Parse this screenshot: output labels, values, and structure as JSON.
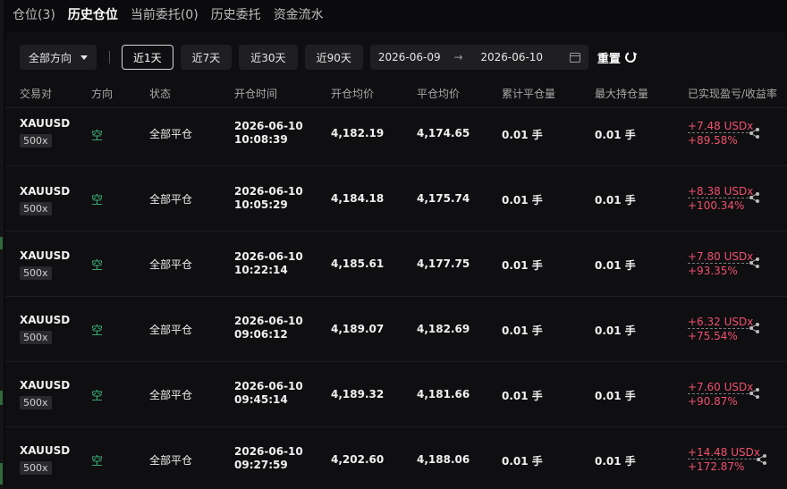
{
  "tabs": [
    {
      "label": "仓位(3)",
      "active": false
    },
    {
      "label": "历史仓位",
      "active": true
    },
    {
      "label": "当前委托(0)",
      "active": false
    },
    {
      "label": "历史委托",
      "active": false
    },
    {
      "label": "资金流水",
      "active": false
    }
  ],
  "filters": {
    "direction": "全部方向",
    "ranges": [
      "近1天",
      "近7天",
      "近30天",
      "近90天"
    ],
    "active_range": 0,
    "date_from": "2026-06-09",
    "date_arrow": "→",
    "date_to": "2026-06-10",
    "reset_label": "重置"
  },
  "columns": [
    "交易对",
    "方向",
    "状态",
    "开仓时间",
    "开仓均价",
    "平仓均价",
    "累计平仓量",
    "最大持仓量",
    "已实现盈亏/收益率"
  ],
  "rows": [
    {
      "symbol": "XAUUSD",
      "leverage": "500x",
      "direction": "空",
      "status": "全部平仓",
      "date": "2026-06-10",
      "time": "10:08:39",
      "open_price": "4,182.19",
      "close_price": "4,174.65",
      "closed_qty": "0.01 手",
      "max_qty": "0.01 手",
      "pnl": "+7.48 USDx",
      "roi": "+89.58%"
    },
    {
      "symbol": "XAUUSD",
      "leverage": "500x",
      "direction": "空",
      "status": "全部平仓",
      "date": "2026-06-10",
      "time": "10:05:29",
      "open_price": "4,184.18",
      "close_price": "4,175.74",
      "closed_qty": "0.01 手",
      "max_qty": "0.01 手",
      "pnl": "+8.38 USDx",
      "roi": "+100.34%"
    },
    {
      "symbol": "XAUUSD",
      "leverage": "500x",
      "direction": "空",
      "status": "全部平仓",
      "date": "2026-06-10",
      "time": "10:22:14",
      "open_price": "4,185.61",
      "close_price": "4,177.75",
      "closed_qty": "0.01 手",
      "max_qty": "0.01 手",
      "pnl": "+7.80 USDx",
      "roi": "+93.35%"
    },
    {
      "symbol": "XAUUSD",
      "leverage": "500x",
      "direction": "空",
      "status": "全部平仓",
      "date": "2026-06-10",
      "time": "09:06:12",
      "open_price": "4,189.07",
      "close_price": "4,182.69",
      "closed_qty": "0.01 手",
      "max_qty": "0.01 手",
      "pnl": "+6.32 USDx",
      "roi": "+75.54%"
    },
    {
      "symbol": "XAUUSD",
      "leverage": "500x",
      "direction": "空",
      "status": "全部平仓",
      "date": "2026-06-10",
      "time": "09:45:14",
      "open_price": "4,189.32",
      "close_price": "4,181.66",
      "closed_qty": "0.01 手",
      "max_qty": "0.01 手",
      "pnl": "+7.60 USDx",
      "roi": "+90.87%"
    },
    {
      "symbol": "XAUUSD",
      "leverage": "500x",
      "direction": "空",
      "status": "全部平仓",
      "date": "2026-06-10",
      "time": "09:27:59",
      "open_price": "4,202.60",
      "close_price": "4,188.06",
      "closed_qty": "0.01 手",
      "max_qty": "0.01 手",
      "pnl": "+14.48 USDx",
      "roi": "+172.87%"
    }
  ],
  "colors": {
    "accent_short": "#3fb67a",
    "pnl_positive": "#f0506e",
    "background": "#0b0b0d"
  },
  "icons": {
    "direction_caret": "chevron-down-icon",
    "calendar": "calendar-icon",
    "reset": "refresh-icon",
    "share": "share-icon"
  }
}
